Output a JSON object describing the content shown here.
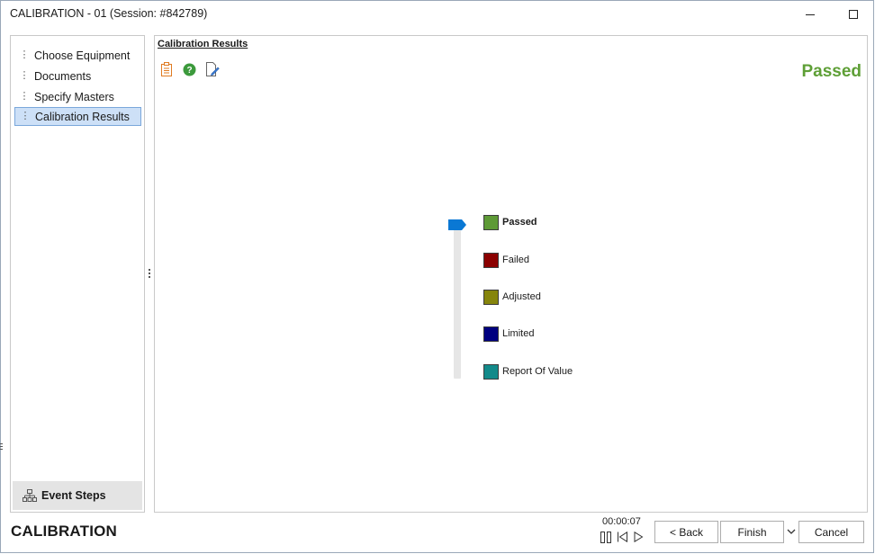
{
  "window": {
    "title": "CALIBRATION - 01 (Session: #842789)"
  },
  "sidebar": {
    "items": [
      {
        "label": "Choose Equipment",
        "active": false
      },
      {
        "label": "Documents",
        "active": false
      },
      {
        "label": "Specify Masters",
        "active": false
      },
      {
        "label": "Calibration Results",
        "active": true
      }
    ],
    "event_steps_label": "Event Steps"
  },
  "main": {
    "section_title": "Calibration Results",
    "toolbar_icons": [
      "clipboard-icon",
      "help-icon",
      "edit-document-icon"
    ],
    "status_text": "Passed",
    "status_color": "#5e9f36",
    "result_levels": [
      {
        "label": "Passed",
        "color": "#5e9a36",
        "selected": true
      },
      {
        "label": "Failed",
        "color": "#8b0000",
        "selected": false
      },
      {
        "label": "Adjusted",
        "color": "#86850c",
        "selected": false
      },
      {
        "label": "Limited",
        "color": "#00007f",
        "selected": false
      },
      {
        "label": "Report Of Value",
        "color": "#138a8a",
        "selected": false
      }
    ],
    "slider_selected_index": 0
  },
  "footer": {
    "app_title": "CALIBRATION",
    "timer": "00:00:07",
    "media_icons": [
      "pause-icon",
      "skip-back-icon",
      "play-icon"
    ],
    "back_label": "< Back",
    "finish_label": "Finish",
    "cancel_label": "Cancel"
  }
}
